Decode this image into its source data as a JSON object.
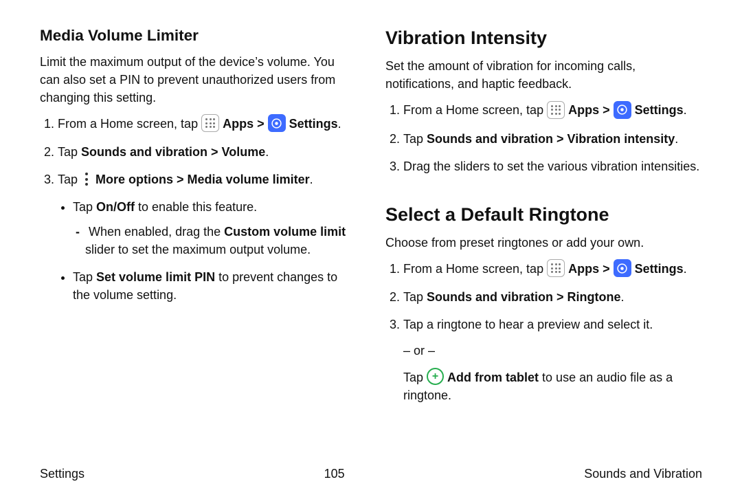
{
  "left": {
    "heading": "Media Volume Limiter",
    "desc": "Limit the maximum output of the device’s volume. You can also set a PIN to prevent unauthorized users from changing this setting.",
    "step1_pre": "From a Home screen, tap ",
    "apps": "Apps",
    "chev": " > ",
    "settings": "Settings",
    "step2_pre": "Tap ",
    "step2_b": "Sounds and vibration > Volume",
    "step3_pre": "Tap ",
    "step3_b": "More options > Media volume limiter",
    "bullet1_pre": "Tap ",
    "bullet1_b": "On/Off",
    "bullet1_post": " to enable this feature.",
    "dash_pre": "When enabled, drag the ",
    "dash_b": "Custom volume limit",
    "dash_post": " slider to set the maximum output volume.",
    "bullet2_pre": "Tap ",
    "bullet2_b": "Set volume limit PIN",
    "bullet2_post": " to prevent changes to the volume setting."
  },
  "right": {
    "vib_heading": "Vibration Intensity",
    "vib_desc": "Set the amount of vibration for incoming calls, notifications, and haptic feedback.",
    "vib_step1_pre": "From a Home screen, tap ",
    "vib_step2_pre": "Tap ",
    "vib_step2_b": "Sounds and vibration > Vibration intensity",
    "vib_step3": "Drag the sliders to set the various vibration intensities.",
    "ring_heading": "Select a Default Ringtone",
    "ring_desc": "Choose from preset ringtones or add your own.",
    "ring_step1_pre": "From a Home screen, tap ",
    "ring_step2_pre": "Tap ",
    "ring_step2_b": "Sounds and vibration > Ringtone",
    "ring_step3": "Tap a ringtone to hear a preview and select it.",
    "or": "– or –",
    "add_pre": "Tap ",
    "add_b": "Add from tablet",
    "add_post": " to use an audio file as a ringtone."
  },
  "common": {
    "apps": "Apps",
    "chev": ">",
    "settings": "Settings",
    "period": "."
  },
  "footer": {
    "left": "Settings",
    "center": "105",
    "right": "Sounds and Vibration"
  }
}
